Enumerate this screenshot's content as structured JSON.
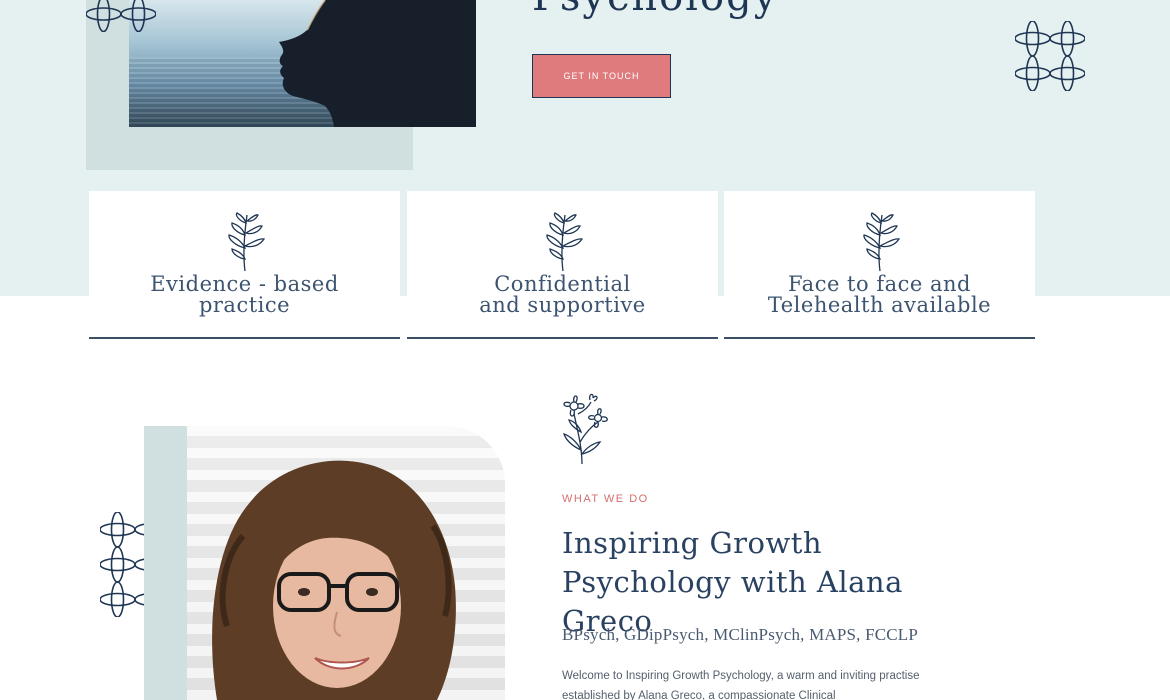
{
  "hero": {
    "title": "Psychology",
    "cta_label": "GET IN TOUCH"
  },
  "features": [
    {
      "lines": [
        "Evidence - based",
        "practice"
      ]
    },
    {
      "lines": [
        "Confidential",
        "and supportive"
      ]
    },
    {
      "lines": [
        "Face to face and",
        "Telehealth available"
      ]
    }
  ],
  "about": {
    "eyebrow": "WHAT WE DO",
    "title": "Inspiring Growth Psychology with Alana Greco",
    "credentials": "BPsych, GDipPsych, MClinPsych, MAPS, FCCLP",
    "intro": "Welcome to Inspiring Growth Psychology, a warm and inviting practise established by Alana Greco, a compassionate Clinical"
  },
  "colors": {
    "hero_bg": "#e5f1f1",
    "accent": "#e07b7d",
    "navy": "#1e3553",
    "panel": "#d0e0e0"
  },
  "icons": [
    "petal-pattern-icon",
    "leaf-sprig-icon",
    "flower-icon"
  ]
}
